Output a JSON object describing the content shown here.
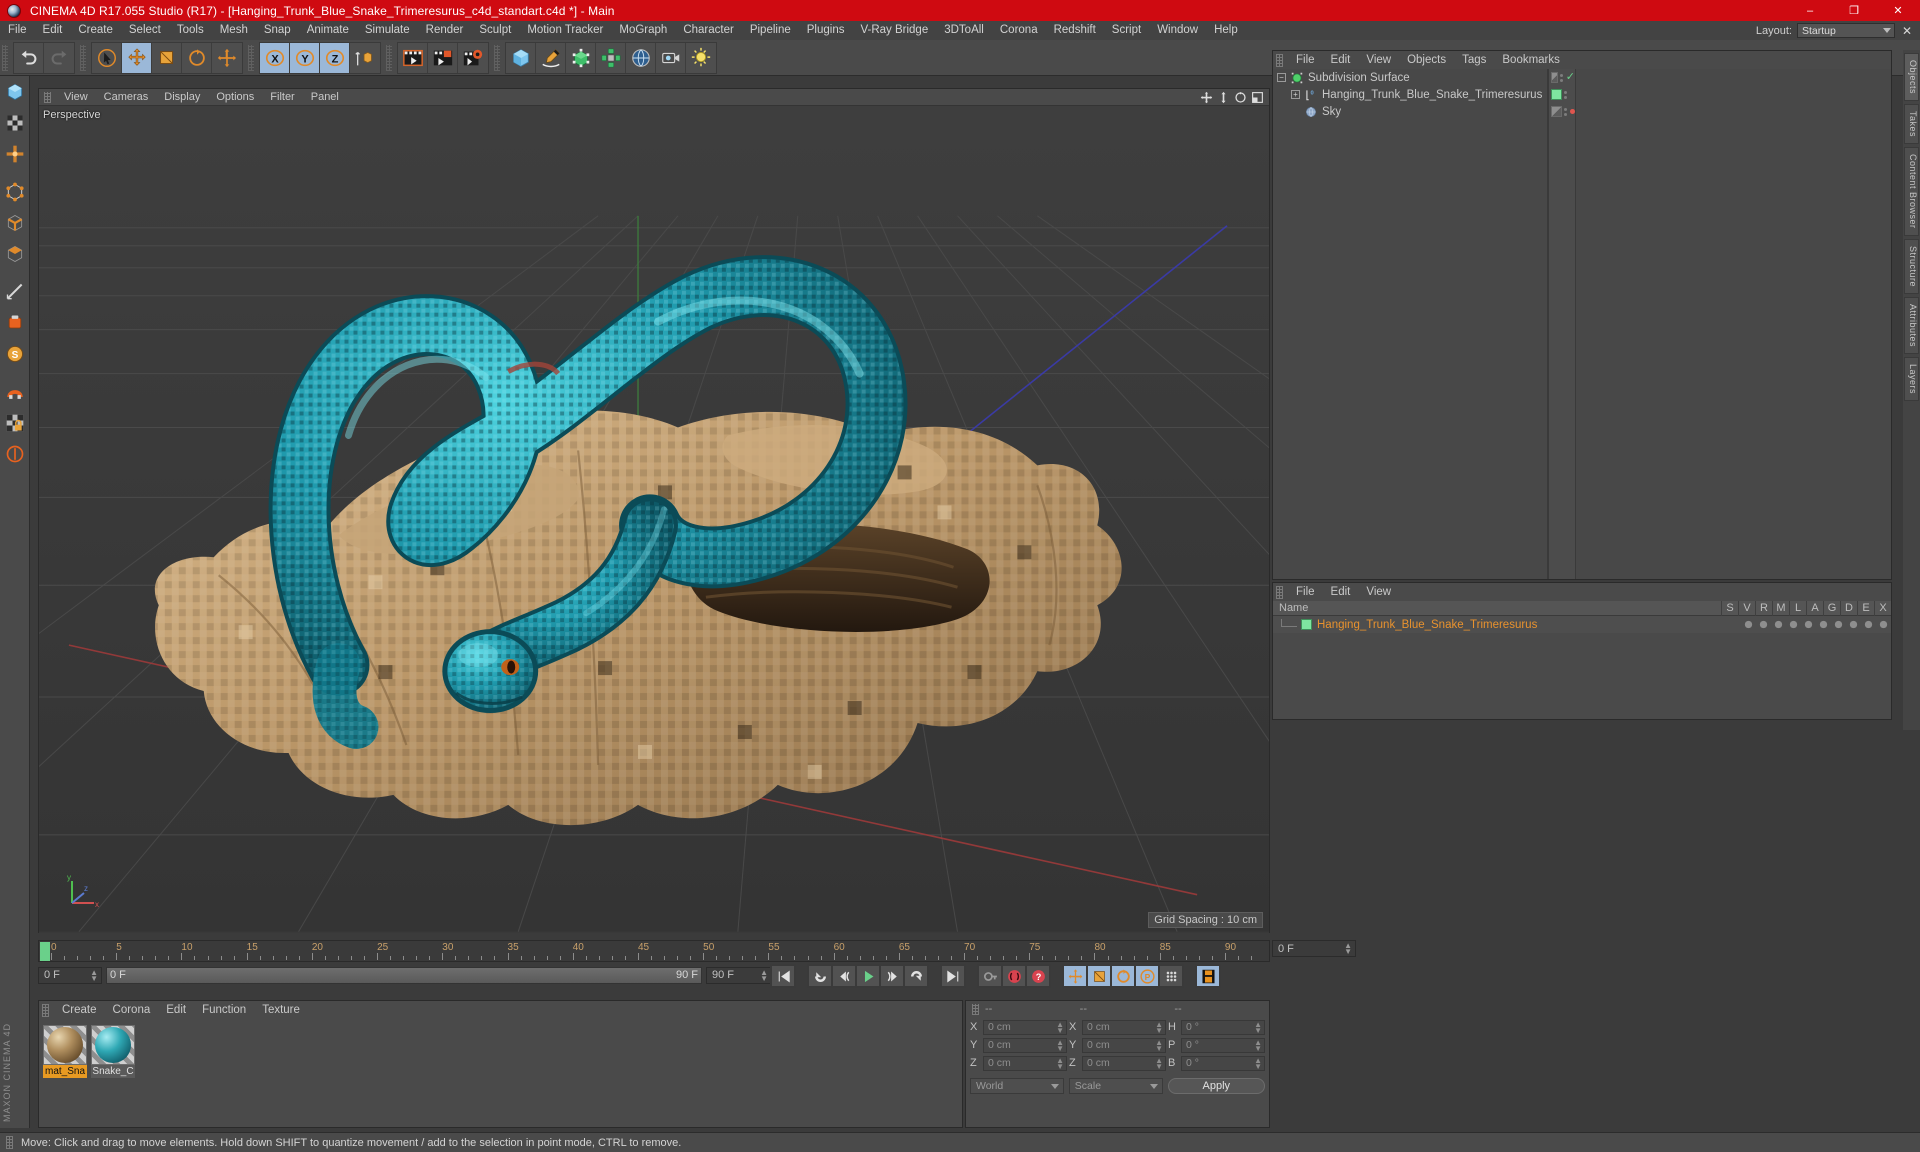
{
  "window": {
    "title": "CINEMA 4D R17.055 Studio (R17) - [Hanging_Trunk_Blue_Snake_Trimeresurus_c4d_standart.c4d *] - Main",
    "minimize": "–",
    "maximize": "❐",
    "close": "✕",
    "titlebar_color": "#cf0a11"
  },
  "menu": {
    "items": [
      "File",
      "Edit",
      "Create",
      "Select",
      "Tools",
      "Mesh",
      "Snap",
      "Animate",
      "Simulate",
      "Render",
      "Sculpt",
      "Motion Tracker",
      "MoGraph",
      "Character",
      "Pipeline",
      "Plugins",
      "V-Ray Bridge",
      "3DToAll",
      "Corona",
      "Redshift",
      "Script",
      "Window",
      "Help"
    ],
    "layout_label": "Layout:",
    "layout_value": "Startup",
    "layout_close": "✕"
  },
  "toolbar": {
    "groups": [
      {
        "name": "undo-redo",
        "buttons": [
          {
            "name": "undo-button",
            "icon": "undo-icon",
            "active": false
          },
          {
            "name": "redo-button",
            "icon": "redo-icon",
            "active": false
          }
        ]
      },
      {
        "name": "transform-tools",
        "buttons": [
          {
            "name": "live-selection-button",
            "icon": "cursor-select-icon",
            "active": false
          },
          {
            "name": "move-tool-button",
            "icon": "move-icon",
            "active": true
          },
          {
            "name": "scale-tool-button",
            "icon": "scale-icon",
            "active": false
          },
          {
            "name": "rotate-tool-button",
            "icon": "rotate-icon",
            "active": false
          },
          {
            "name": "move-axis-button",
            "icon": "axis-move-icon",
            "active": false
          }
        ]
      },
      {
        "name": "axis-locks",
        "buttons": [
          {
            "name": "lock-x-button",
            "icon": "x-axis-icon",
            "active": true
          },
          {
            "name": "lock-y-button",
            "icon": "y-axis-icon",
            "active": true
          },
          {
            "name": "lock-z-button",
            "icon": "z-axis-icon",
            "active": true
          },
          {
            "name": "world-object-toggle",
            "icon": "world-coord-icon",
            "active": false
          }
        ]
      },
      {
        "name": "render-group",
        "buttons": [
          {
            "name": "render-view-button",
            "icon": "render-view-icon",
            "active": false
          },
          {
            "name": "render-to-picture-viewer-button",
            "icon": "render-picture-icon",
            "active": false
          },
          {
            "name": "render-settings-button",
            "icon": "render-settings-icon",
            "active": false
          }
        ]
      },
      {
        "name": "create-group",
        "buttons": [
          {
            "name": "add-cube-button",
            "icon": "cube-icon",
            "active": false
          },
          {
            "name": "add-spline-button",
            "icon": "pen-spline-icon",
            "active": false
          },
          {
            "name": "generators-button",
            "icon": "generator-cube-icon",
            "active": false
          },
          {
            "name": "deformers-button",
            "icon": "deformer-icon",
            "active": false
          },
          {
            "name": "add-environment-button",
            "icon": "environment-icon",
            "active": false
          },
          {
            "name": "add-camera-button",
            "icon": "camera-icon",
            "active": false
          },
          {
            "name": "add-light-button",
            "icon": "light-icon",
            "active": false
          }
        ]
      }
    ]
  },
  "left_palette": {
    "buttons": [
      {
        "name": "tool-model-mode",
        "icon": "model-mode-icon"
      },
      {
        "name": "tool-texture-mode",
        "icon": "texture-mode-icon"
      },
      {
        "name": "tool-object-axis",
        "icon": "object-axis-icon"
      },
      {
        "name": "tool-point-mode",
        "icon": "point-mode-icon"
      },
      {
        "name": "tool-edge-mode",
        "icon": "edge-mode-icon"
      },
      {
        "name": "tool-polygon-mode",
        "icon": "polygon-mode-icon"
      },
      {
        "name": "tool-measure",
        "icon": "measure-icon"
      },
      {
        "name": "tool-workplane",
        "icon": "workplane-icon"
      },
      {
        "name": "tool-uv-mode",
        "icon": "uv-mode-icon"
      },
      {
        "name": "tool-snap",
        "icon": "snap-magnet-icon"
      },
      {
        "name": "tool-texture-lock",
        "icon": "texture-lock-icon"
      },
      {
        "name": "tool-viewport-solo",
        "icon": "viewport-solo-icon"
      }
    ],
    "brand": "MAXON CINEMA 4D"
  },
  "viewport": {
    "menu": [
      "View",
      "Cameras",
      "Display",
      "Options",
      "Filter",
      "Panel"
    ],
    "label": "Perspective",
    "grid_spacing": "Grid Spacing : 10 cm",
    "icons": [
      {
        "name": "viewport-move-icon"
      },
      {
        "name": "viewport-scale-icon"
      },
      {
        "name": "viewport-rotate-icon"
      },
      {
        "name": "viewport-maximize-icon"
      }
    ],
    "axis_labels": {
      "x": "x",
      "y": "y",
      "z": "z"
    }
  },
  "object_manager": {
    "menu": [
      "File",
      "Edit",
      "View",
      "Objects",
      "Tags",
      "Bookmarks"
    ],
    "rows": [
      {
        "name": "Subdivision Surface",
        "indent": 0,
        "icon": "subdivision-surface-icon",
        "expander": "−",
        "tag": "checker",
        "dot_state": "enabled"
      },
      {
        "name": "Hanging_Trunk_Blue_Snake_Trimeresurus",
        "indent": 1,
        "icon": "polygon-object-icon",
        "expander": "+",
        "tag": "green",
        "dot_state": "none"
      },
      {
        "name": "Sky",
        "indent": 1,
        "icon": "sky-icon",
        "expander": "",
        "tag": "checker",
        "dot_state": "red"
      }
    ]
  },
  "material_manager_right": {
    "menu": [
      "File",
      "Edit",
      "View"
    ],
    "columns": [
      "Name",
      "S",
      "V",
      "R",
      "M",
      "L",
      "A",
      "G",
      "D",
      "E",
      "X"
    ],
    "rows": [
      {
        "name": "Hanging_Trunk_Blue_Snake_Trimeresurus",
        "color": "#7ee6a0"
      }
    ]
  },
  "right_tabs": [
    {
      "label": "Objects",
      "name": "tab-objects",
      "selected": true
    },
    {
      "label": "Takes",
      "name": "tab-takes",
      "selected": false
    },
    {
      "label": "Content Browser",
      "name": "tab-content-browser",
      "selected": false
    },
    {
      "label": "Structure",
      "name": "tab-structure",
      "selected": false
    },
    {
      "label": "Attributes",
      "name": "tab-attributes",
      "selected": false
    },
    {
      "label": "Layers",
      "name": "tab-layers",
      "selected": false
    }
  ],
  "timeline": {
    "ticks": [
      0,
      5,
      10,
      15,
      20,
      25,
      30,
      35,
      40,
      45,
      50,
      55,
      60,
      65,
      70,
      75,
      80,
      85,
      90
    ],
    "current_frame_field": "0 F",
    "start_field": "0 F",
    "end_field": "90 F",
    "preview_end": "90 F",
    "right_frame_field": "0 F",
    "controls": [
      {
        "name": "go-to-start-button",
        "icon": "skip-start-icon"
      },
      {
        "name": "play-back-button",
        "icon": "rewind-icon"
      },
      {
        "name": "step-back-button",
        "icon": "step-back-icon"
      },
      {
        "name": "play-forward-button",
        "icon": "play-icon"
      },
      {
        "name": "step-forward-button",
        "icon": "step-forward-icon"
      },
      {
        "name": "loop-button",
        "icon": "loop-icon"
      },
      {
        "name": "go-to-end-button",
        "icon": "skip-end-icon"
      },
      {
        "name": "autokey-button",
        "icon": "key-icon"
      },
      {
        "name": "record-active-objects-button",
        "icon": "record-icon"
      },
      {
        "name": "keyframe-selection-button",
        "icon": "keyframe-question-icon"
      },
      {
        "name": "position-key-button",
        "icon": "position-key-icon"
      },
      {
        "name": "scale-key-button",
        "icon": "scale-key-icon"
      },
      {
        "name": "rotation-key-button",
        "icon": "rotation-key-icon"
      },
      {
        "name": "param-key-button",
        "icon": "param-key-icon"
      },
      {
        "name": "point-level-animation-button",
        "icon": "pla-icon"
      },
      {
        "name": "timeline-view-button",
        "icon": "timeline-filmstrip-icon"
      }
    ]
  },
  "material_manager": {
    "menu": [
      "Create",
      "Corona",
      "Edit",
      "Function",
      "Texture"
    ],
    "materials": [
      {
        "name": "mat_Sna",
        "full_name": "mat_Snake_trunk",
        "selected": true,
        "color": "#9b7a4e"
      },
      {
        "name": "Snake_C",
        "full_name": "Snake_Color",
        "selected": false,
        "color": "#2fa8b4"
      }
    ]
  },
  "coordinates": {
    "headers": [
      "--",
      "--",
      "--"
    ],
    "rows": [
      {
        "label_pos": "X",
        "value_pos": "0 cm",
        "label_size": "X",
        "value_size": "0 cm",
        "label_rot": "H",
        "value_rot": "0 °"
      },
      {
        "label_pos": "Y",
        "value_pos": "0 cm",
        "label_size": "Y",
        "value_size": "0 cm",
        "label_rot": "P",
        "value_rot": "0 °"
      },
      {
        "label_pos": "Z",
        "value_pos": "0 cm",
        "label_size": "Z",
        "value_size": "0 cm",
        "label_rot": "B",
        "value_rot": "0 °"
      }
    ],
    "system": "World",
    "mode": "Scale",
    "apply": "Apply"
  },
  "statusbar": {
    "text": "Move: Click and drag to move elements. Hold down SHIFT to quantize movement / add to the selection in point mode, CTRL to remove."
  },
  "colors": {
    "accent_red": "#cf0a11",
    "panel_bg": "#4a4a4a",
    "viewport_bg": "#393939",
    "selected_orange": "#e8922e",
    "snake_teal": "#1f9aad",
    "trunk_tan": "#c5a378",
    "active_blue": "#9bb8d8"
  }
}
